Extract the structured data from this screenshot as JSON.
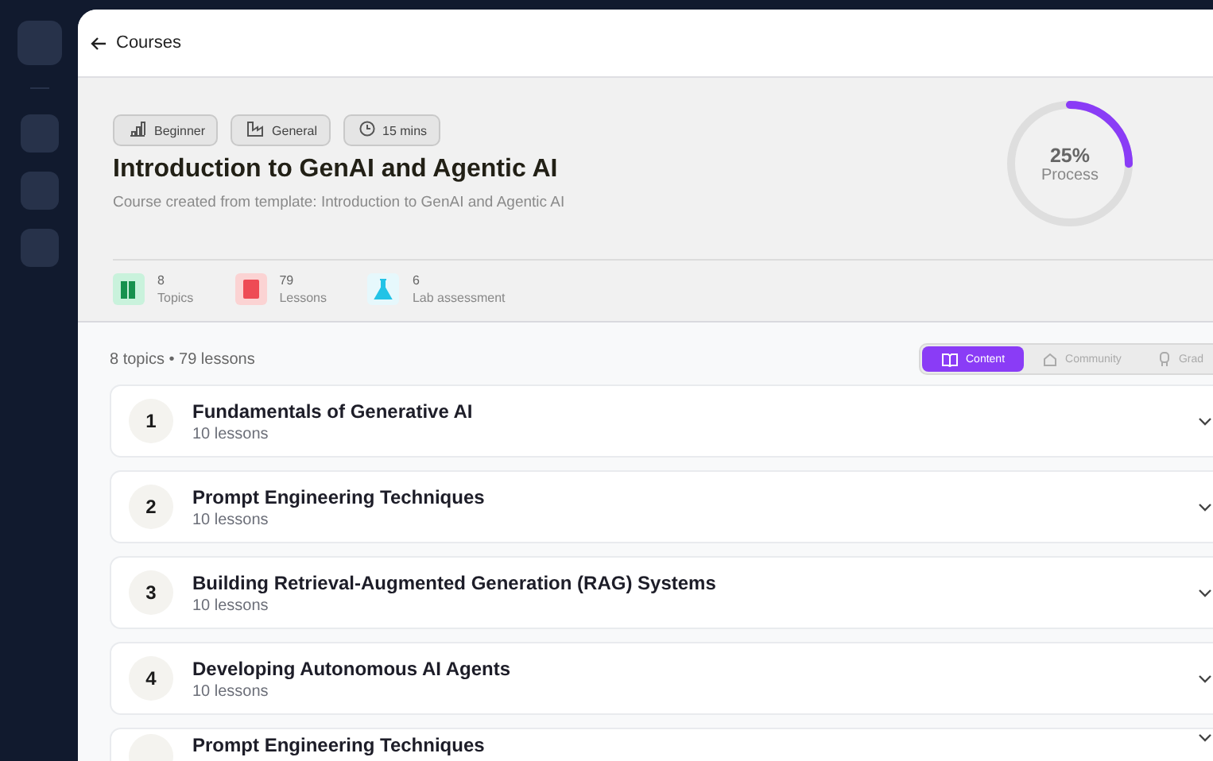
{
  "header": {
    "back_label": "Courses"
  },
  "course": {
    "chips": [
      {
        "kind": "level",
        "label": "Beginner"
      },
      {
        "kind": "category",
        "label": "General"
      },
      {
        "kind": "time",
        "label": "15 mins"
      }
    ],
    "title": "Introduction to GenAI and Agentic AI",
    "subtitle": "Course created from template: Introduction to GenAI and Agentic AI",
    "progress": {
      "level": 0.25,
      "reading": "25%",
      "label": "Process"
    },
    "stats": [
      {
        "kind": "topics",
        "value": "8",
        "label": "Topics"
      },
      {
        "kind": "lessons",
        "value": "79",
        "label": "Lessons"
      },
      {
        "kind": "lab",
        "value": "6",
        "label": "Lab assessment"
      }
    ]
  },
  "list": {
    "summary": "8 topics • 79 lessons",
    "tabs": [
      {
        "kind": "content",
        "label": "Content",
        "selected": true
      },
      {
        "kind": "community",
        "label": "Community",
        "selected": false
      },
      {
        "kind": "grades",
        "label": "Grad",
        "selected": false
      }
    ],
    "topics": [
      {
        "number": "1",
        "title": "Fundamentals of Generative AI",
        "lessons": "10 lessons"
      },
      {
        "number": "2",
        "title": "Prompt Engineering Techniques",
        "lessons": "10 lessons"
      },
      {
        "number": "3",
        "title": "Building Retrieval-Augmented Generation (RAG) Systems",
        "lessons": "10 lessons"
      },
      {
        "number": "4",
        "title": "Developing Autonomous AI Agents",
        "lessons": "10 lessons"
      },
      {
        "title": "Prompt Engineering Techniques"
      }
    ]
  }
}
